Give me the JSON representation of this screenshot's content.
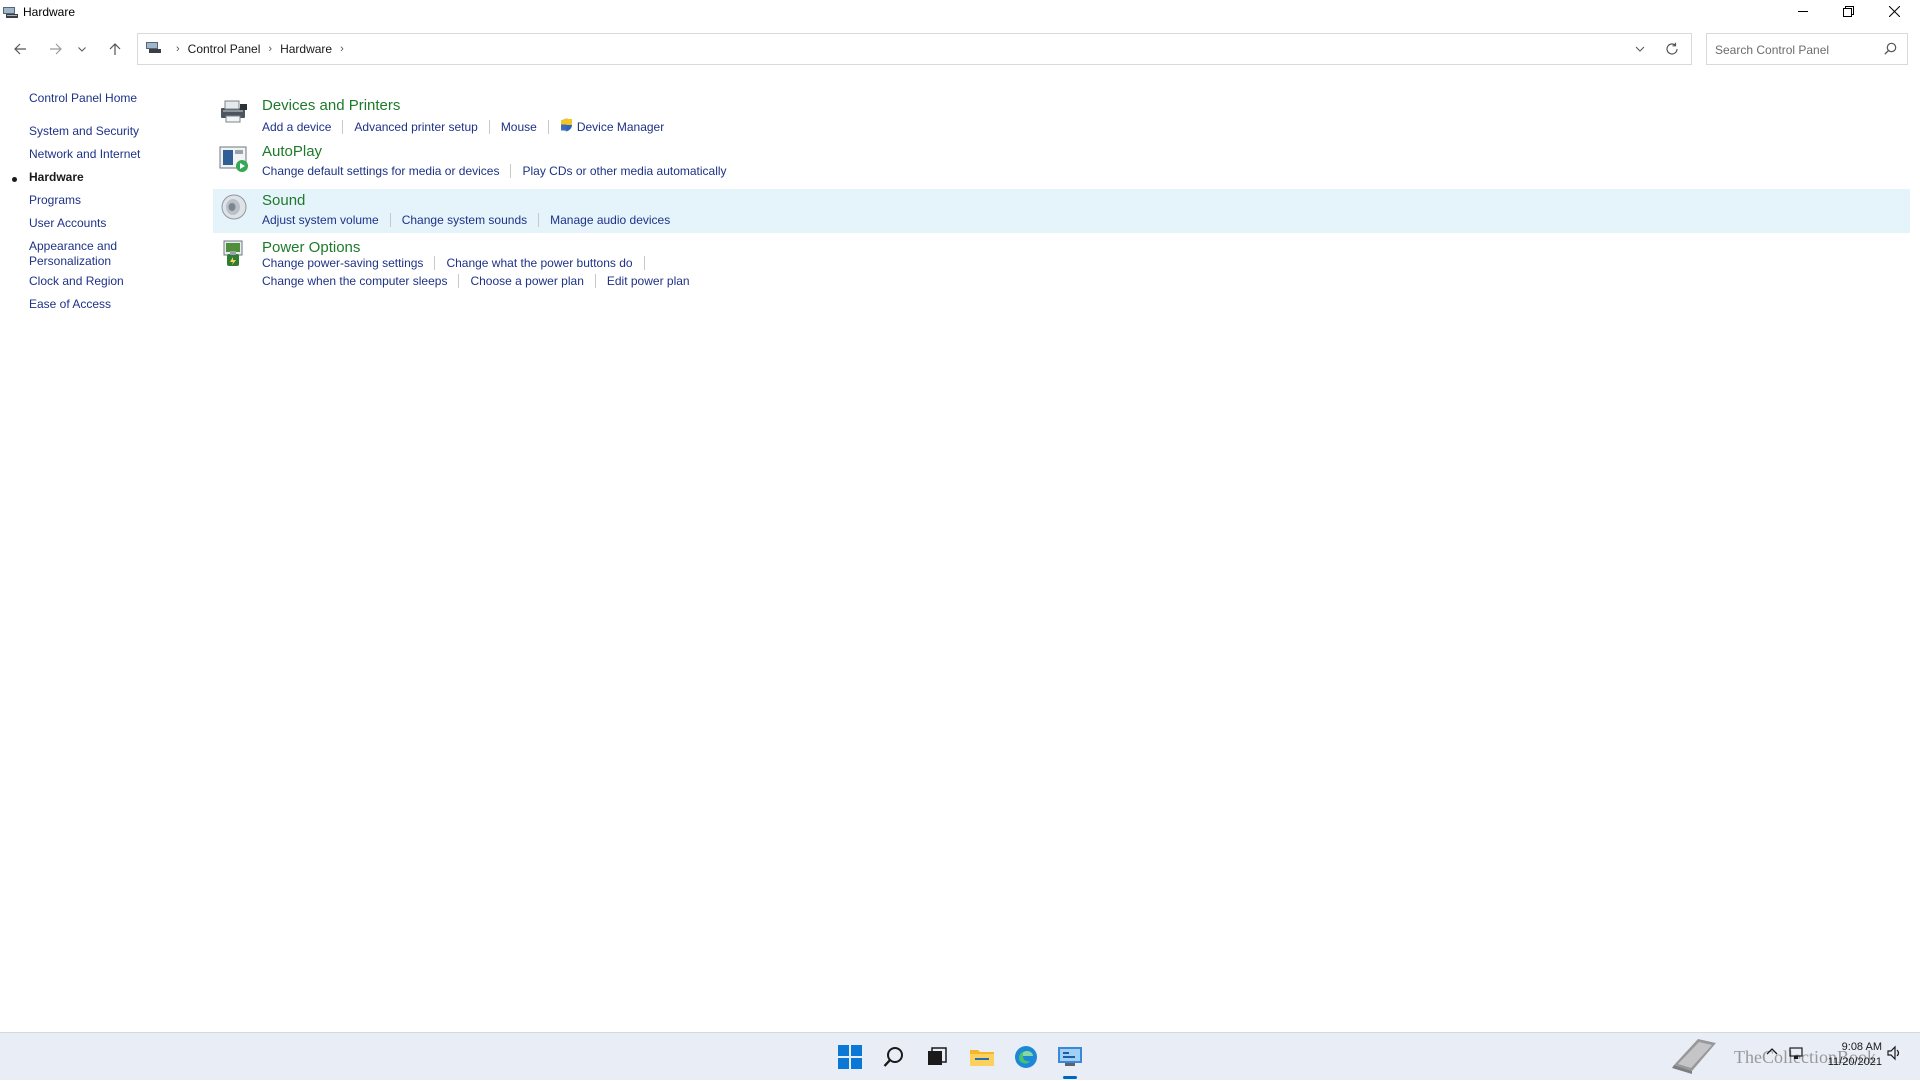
{
  "window": {
    "title": "Hardware",
    "controls": [
      "minimize-icon",
      "restore-icon",
      "close-icon"
    ]
  },
  "navigation": {
    "back": "back-arrow-icon",
    "forward": "forward-arrow-icon",
    "recent": "chevron-down-icon",
    "up": "up-arrow-icon"
  },
  "address": {
    "crumbs": [
      "Control Panel",
      "Hardware"
    ],
    "dropdown": "chevron-down-icon",
    "refresh": "refresh-icon"
  },
  "search": {
    "placeholder": "Search Control Panel",
    "value": ""
  },
  "sidebar": {
    "home": "Control Panel Home",
    "items": [
      {
        "label": "System and Security"
      },
      {
        "label": "Network and Internet"
      },
      {
        "label": "Hardware",
        "active": true
      },
      {
        "label": "Programs"
      },
      {
        "label": "User Accounts"
      },
      {
        "label": "Appearance and\nPersonalization"
      },
      {
        "label": "Clock and Region"
      },
      {
        "label": "Ease of Access"
      }
    ]
  },
  "sections": [
    {
      "title": "Devices and Printers",
      "icon": "printer-icon",
      "links": [
        [
          "Add a device",
          "Advanced printer setup",
          "Mouse",
          "Device Manager"
        ]
      ]
    },
    {
      "title": "AutoPlay",
      "icon": "autoplay-icon",
      "links": [
        [
          "Change default settings for media or devices",
          "Play CDs or other media automatically"
        ]
      ]
    },
    {
      "title": "Sound",
      "icon": "speaker-icon",
      "highlighted": true,
      "links": [
        [
          "Adjust system volume",
          "Change system sounds",
          "Manage audio devices"
        ]
      ]
    },
    {
      "title": "Power Options",
      "icon": "power-options-icon",
      "links": [
        [
          "Change power-saving settings",
          "Change what the power buttons do"
        ],
        [
          "Change when the computer sleeps",
          "Choose a power plan",
          "Edit power plan"
        ]
      ]
    }
  ],
  "taskbar": {
    "apps": [
      "start-icon",
      "search-icon",
      "task-view-icon",
      "file-explorer-icon",
      "edge-icon",
      "control-panel-icon"
    ],
    "active_app": "control-panel-icon",
    "tray": [
      "chevron-up-icon",
      "network-icon",
      "speaker-icon"
    ],
    "time": "9:08 AM",
    "date": "11/20/2021",
    "watermark": "TheCollectionBook"
  },
  "colors": {
    "link": "#1e3287",
    "section_title": "#1e7a2a",
    "hover_row": "#e5f3fb",
    "taskbar": "#e9eef6",
    "accent": "#0067c0"
  }
}
